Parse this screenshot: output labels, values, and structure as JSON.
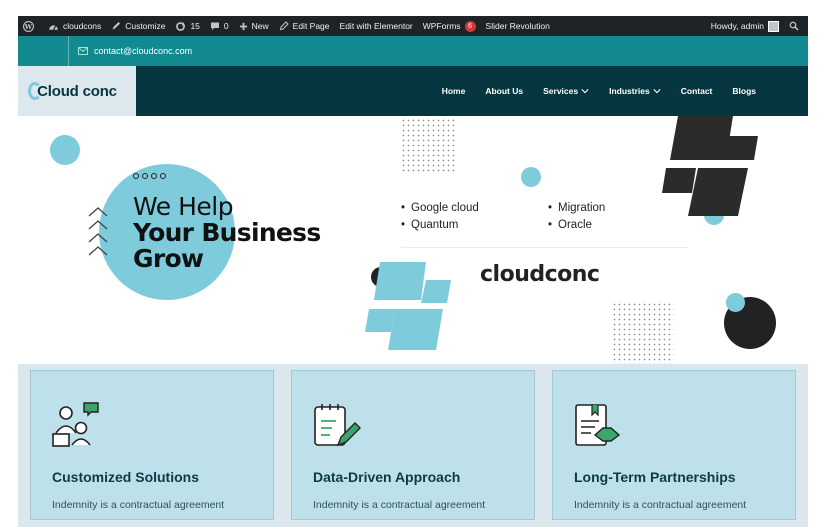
{
  "admin_bar": {
    "site_name": "cloudcons",
    "customize": "Customize",
    "updates_count": "15",
    "comments_count": "0",
    "new_label": "New",
    "edit_page": "Edit Page",
    "edit_elementor": "Edit with Elementor",
    "wpforms": "WPForms",
    "wpforms_badge": "6",
    "slider_revolution": "Slider Revolution",
    "howdy": "Howdy, admin"
  },
  "topbar": {
    "email": "contact@cloudconc.com"
  },
  "header": {
    "logo_text": "Cloud conc",
    "nav": {
      "home": "Home",
      "about": "About Us",
      "services": "Services",
      "industries": "Industries",
      "contact": "Contact",
      "blogs": "Blogs"
    }
  },
  "hero": {
    "line1": "We Help",
    "line2": "Your Business",
    "line3": "Grow",
    "services_left": [
      "Google cloud",
      "Quantum"
    ],
    "services_right": [
      "Migration",
      "Oracle"
    ],
    "brand": "cloudconc"
  },
  "features": {
    "cards": [
      {
        "title": "Customized Solutions",
        "text": "Indemnity is a contractual agreement"
      },
      {
        "title": "Data-Driven Approach",
        "text": "Indemnity is a contractual agreement"
      },
      {
        "title": "Long-Term Partnerships",
        "text": "Indemnity is a contractual agreement"
      }
    ]
  },
  "colors": {
    "admin_bar": "#1d2327",
    "teal": "#128a90",
    "navy": "#063640",
    "light_blue": "#7ecbdc",
    "card_bg": "#bde0ea",
    "badge_red": "#d63638"
  }
}
